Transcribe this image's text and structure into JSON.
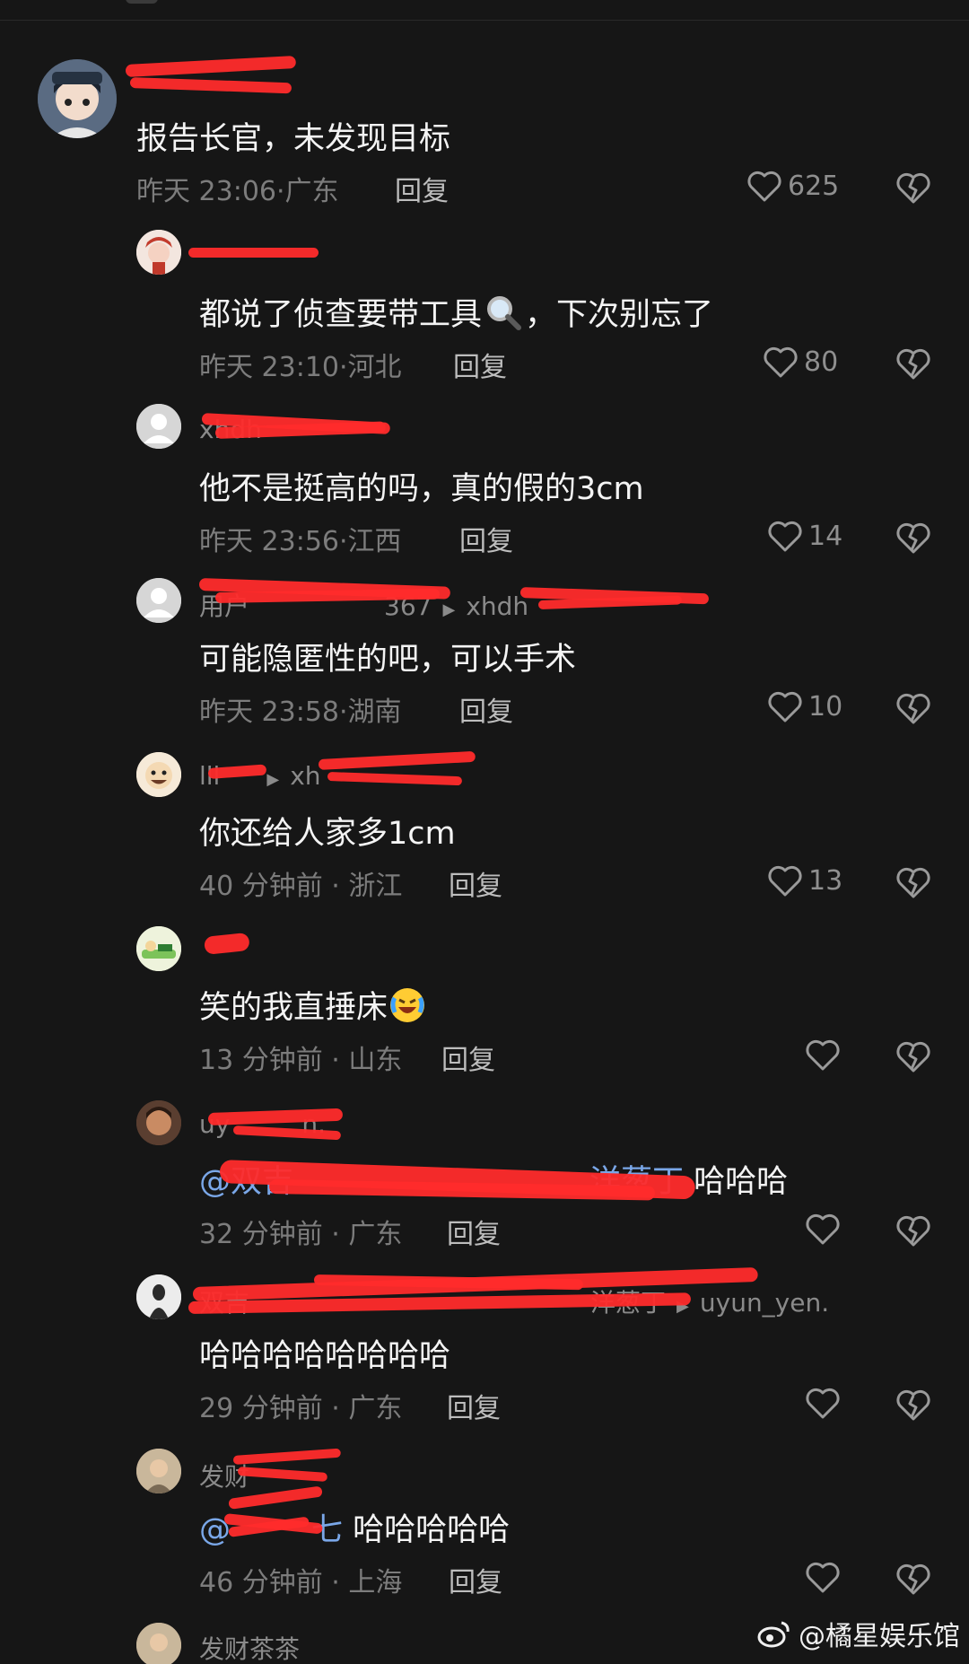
{
  "comments": [
    {
      "text": "报告长官，未发现目标",
      "time": "昨天 23:06",
      "loc": "广东",
      "reply": "回复",
      "likes": "625"
    },
    {
      "text_a": "都说了侦查要带工具",
      "text_b": "，下次别忘了",
      "time": "昨天 23:10",
      "loc": "河北",
      "reply": "回复",
      "likes": "80"
    },
    {
      "name": "xhdh",
      "text": "他不是挺高的吗，真的假的3cm",
      "time": "昨天 23:56",
      "loc": "江西",
      "reply": "回复",
      "likes": "14"
    },
    {
      "name": "用户",
      "name_tail": "367",
      "to": "xhdh",
      "text": "可能隐匿性的吧，可以手术",
      "time": "昨天 23:58",
      "loc": "湖南",
      "reply": "回复",
      "likes": "10"
    },
    {
      "name": "lll",
      "to": "xh",
      "text": "你还给人家多1cm",
      "time": "40 分钟前",
      "loc": "浙江",
      "reply": "回复",
      "likes": "13"
    },
    {
      "text": "笑的我直捶床",
      "time": "13 分钟前",
      "loc": "山东",
      "reply": "回复"
    },
    {
      "name": "uy",
      "name_tail": "n.",
      "mention": "@双吉",
      "mention_tail": "洋葱丁",
      "text": "哈哈哈",
      "time": "32 分钟前",
      "loc": "广东",
      "reply": "回复"
    },
    {
      "name": "双吉",
      "name_tail": "洋葱丁",
      "to": "uyun_yen.",
      "text": "哈哈哈哈哈哈哈哈",
      "time": "29 分钟前",
      "loc": "广东",
      "reply": "回复"
    },
    {
      "name": "发财",
      "mention": "@",
      "mention_tail": "七",
      "text": "哈哈哈哈哈",
      "time": "46 分钟前",
      "loc": "上海",
      "reply": "回复"
    },
    {
      "name": "发财茶茶"
    }
  ],
  "watermark": "@橘星娱乐馆",
  "colors": {
    "background": "#161616",
    "redaction": "#ff2b2b",
    "mention": "#7aa7e8"
  }
}
